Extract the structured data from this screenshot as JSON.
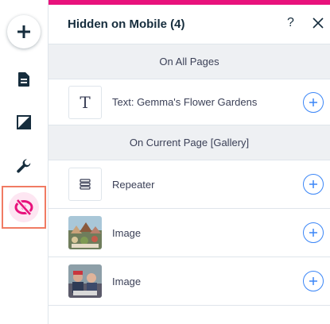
{
  "panel": {
    "title": "Hidden on Mobile (4)",
    "help_label": "?"
  },
  "sections": {
    "all_pages": "On All Pages",
    "current_page": "On Current Page [Gallery]"
  },
  "items": {
    "text": {
      "label": "Text: Gemma's Flower Gardens",
      "icon": "text-t-icon"
    },
    "repeater": {
      "label": "Repeater",
      "icon": "repeater-icon"
    },
    "image1": {
      "label": "Image",
      "icon": "image-thumbnail"
    },
    "image2": {
      "label": "Image",
      "icon": "image-thumbnail"
    }
  },
  "rail": {
    "icons": [
      "plus-icon",
      "page-icon",
      "background-icon",
      "wrench-icon",
      "hidden-eye-icon"
    ],
    "active": "hidden-eye-icon"
  },
  "colors": {
    "accent_pink": "#e8127c",
    "plus_blue": "#3b86f7",
    "highlight_orange": "#f07b63",
    "section_bg": "#eef0f3"
  }
}
